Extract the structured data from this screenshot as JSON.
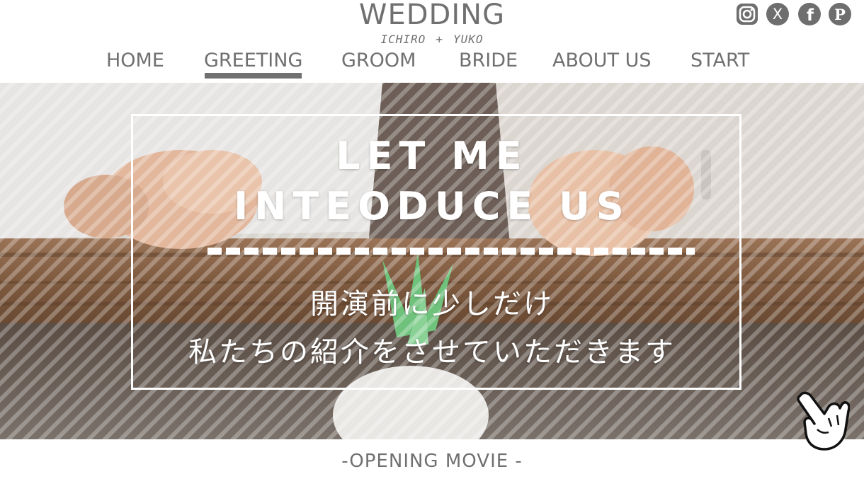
{
  "header": {
    "title": "WEDDING",
    "couple": {
      "groom": "ICHIRO",
      "separator": "+",
      "bride": "YUKO"
    }
  },
  "nav": {
    "items": [
      {
        "label": "HOME"
      },
      {
        "label": "GREETING",
        "active": true
      },
      {
        "label": "GROOM"
      },
      {
        "label": "BRIDE"
      },
      {
        "label": "ABOUT US"
      },
      {
        "label": "START"
      }
    ]
  },
  "social": {
    "icons": [
      "instagram-icon",
      "x-icon",
      "facebook-icon",
      "pinterest-icon"
    ],
    "x_glyph": "X",
    "facebook_glyph": "f",
    "pinterest_glyph": "P"
  },
  "hero": {
    "title_line1": "LET ME",
    "title_line2": "INTEODUCE US",
    "jp_line1": "開演前に少しだけ",
    "jp_line2": "私たちの紹介をさせていただきます"
  },
  "section": {
    "heading": "-OPENING MOVIE -"
  },
  "colors": {
    "text_gray": "#707070",
    "white": "#ffffff",
    "icon_fill": "#6e6e6e"
  }
}
